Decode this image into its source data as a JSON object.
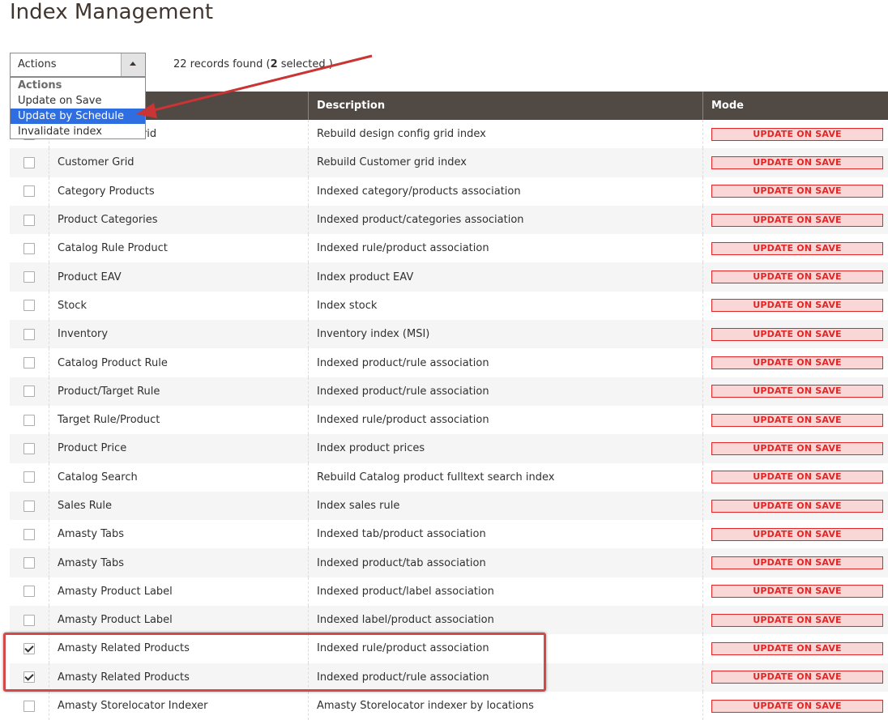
{
  "page": {
    "title": "Index Management"
  },
  "actions": {
    "label": "Actions",
    "dropdown": {
      "header": "Actions",
      "options": [
        "Update on Save",
        "Update by Schedule",
        "Invalidate index"
      ],
      "selected": "Update by Schedule"
    }
  },
  "records": {
    "prefix": "22 records found (",
    "selected_count": "2",
    "suffix": " selected )"
  },
  "grid": {
    "columns": [
      "",
      "Description",
      "Mode"
    ],
    "rows": [
      {
        "title": "Design Config Grid",
        "description": "Rebuild design config grid index",
        "mode": "UPDATE ON SAVE",
        "checked": false
      },
      {
        "title": "Customer Grid",
        "description": "Rebuild Customer grid index",
        "mode": "UPDATE ON SAVE",
        "checked": false
      },
      {
        "title": "Category Products",
        "description": "Indexed category/products association",
        "mode": "UPDATE ON SAVE",
        "checked": false
      },
      {
        "title": "Product Categories",
        "description": "Indexed product/categories association",
        "mode": "UPDATE ON SAVE",
        "checked": false
      },
      {
        "title": "Catalog Rule Product",
        "description": "Indexed rule/product association",
        "mode": "UPDATE ON SAVE",
        "checked": false
      },
      {
        "title": "Product EAV",
        "description": "Index product EAV",
        "mode": "UPDATE ON SAVE",
        "checked": false
      },
      {
        "title": "Stock",
        "description": "Index stock",
        "mode": "UPDATE ON SAVE",
        "checked": false
      },
      {
        "title": "Inventory",
        "description": "Inventory index (MSI)",
        "mode": "UPDATE ON SAVE",
        "checked": false
      },
      {
        "title": "Catalog Product Rule",
        "description": "Indexed product/rule association",
        "mode": "UPDATE ON SAVE",
        "checked": false
      },
      {
        "title": "Product/Target Rule",
        "description": "Indexed product/rule association",
        "mode": "UPDATE ON SAVE",
        "checked": false
      },
      {
        "title": "Target Rule/Product",
        "description": "Indexed rule/product association",
        "mode": "UPDATE ON SAVE",
        "checked": false
      },
      {
        "title": "Product Price",
        "description": "Index product prices",
        "mode": "UPDATE ON SAVE",
        "checked": false
      },
      {
        "title": "Catalog Search",
        "description": "Rebuild Catalog product fulltext search index",
        "mode": "UPDATE ON SAVE",
        "checked": false
      },
      {
        "title": "Sales Rule",
        "description": "Index sales rule",
        "mode": "UPDATE ON SAVE",
        "checked": false
      },
      {
        "title": "Amasty Tabs",
        "description": "Indexed tab/product association",
        "mode": "UPDATE ON SAVE",
        "checked": false
      },
      {
        "title": "Amasty Tabs",
        "description": "Indexed product/tab association",
        "mode": "UPDATE ON SAVE",
        "checked": false
      },
      {
        "title": "Amasty Product Label",
        "description": "Indexed product/label association",
        "mode": "UPDATE ON SAVE",
        "checked": false
      },
      {
        "title": "Amasty Product Label",
        "description": "Indexed label/product association",
        "mode": "UPDATE ON SAVE",
        "checked": false
      },
      {
        "title": "Amasty Related Products",
        "description": "Indexed rule/product association",
        "mode": "UPDATE ON SAVE",
        "checked": true
      },
      {
        "title": "Amasty Related Products",
        "description": "Indexed product/rule association",
        "mode": "UPDATE ON SAVE",
        "checked": true
      },
      {
        "title": "Amasty Storelocator Indexer",
        "description": "Amasty Storelocator indexer by locations",
        "mode": "UPDATE ON SAVE",
        "checked": false
      }
    ]
  },
  "colors": {
    "header_bg": "#514943",
    "mode_badge_text": "#e22626",
    "mode_badge_bg": "#fad7d7",
    "dropdown_selected": "#2e6ee0",
    "annotation": "#d34848"
  }
}
